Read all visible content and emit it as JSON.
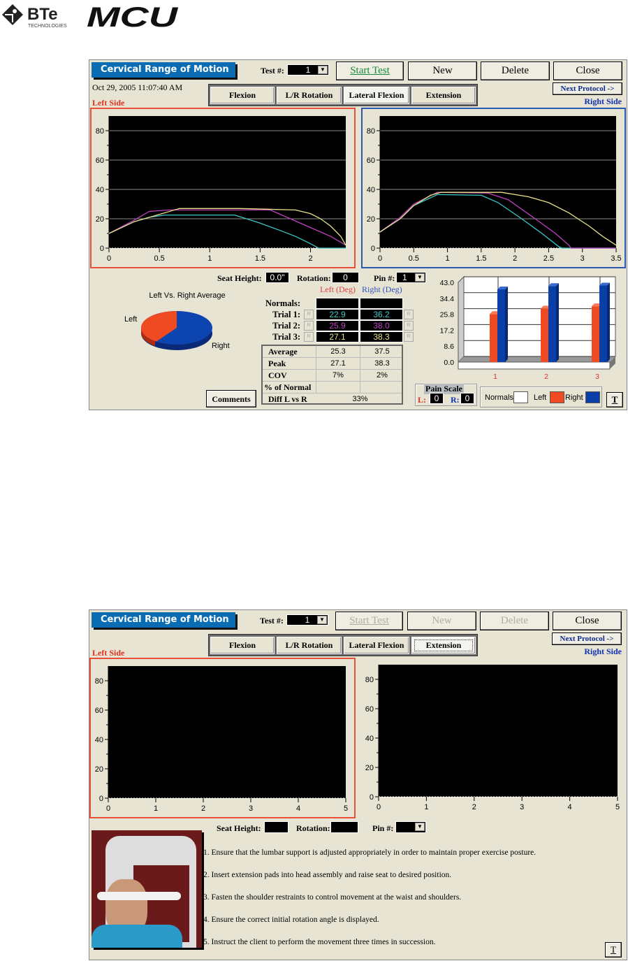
{
  "header": {
    "logo_left": "BTE TECHNOLOGIES",
    "logo_right": "MCU"
  },
  "panels": [
    {
      "title": "Cervical Range of Motion",
      "test_label": "Test #:",
      "test_value": "1",
      "buttons": {
        "start": "Start Test",
        "new": "New",
        "delete": "Delete",
        "close": "Close",
        "next": "Next Protocol ->",
        "comments": "Comments",
        "t": "T"
      },
      "buttons_disabled": false,
      "timestamp": "Oct 29, 2005 11:07:40 AM",
      "tabs": [
        "Flexion",
        "L/R Rotation",
        "Lateral Flexion",
        "Extension"
      ],
      "active_tab": 2,
      "left_side": "Left Side",
      "right_side": "Right Side",
      "seat_height_label": "Seat Height:",
      "seat_height": "0.0\"",
      "rotation_label": "Rotation:",
      "rotation": "0",
      "pin_label": "Pin #:",
      "pin": "1"
    },
    {
      "title": "Cervical Range of Motion",
      "test_label": "Test #:",
      "test_value": "1",
      "buttons": {
        "start": "Start Test",
        "new": "New",
        "delete": "Delete",
        "close": "Close",
        "next": "Next Protocol ->",
        "t": "T"
      },
      "buttons_disabled": true,
      "tabs": [
        "Flexion",
        "L/R Rotation",
        "Lateral Flexion",
        "Extension"
      ],
      "active_tab": 3,
      "left_side": "Left Side",
      "right_side": "Right Side",
      "seat_height_label": "Seat Height:",
      "seat_height": "",
      "rotation_label": "Rotation:",
      "rotation": "",
      "pin_label": "Pin #:",
      "pin": "",
      "instructions": [
        "1.  Ensure that the lumbar support is adjusted appropriately in order to maintain proper exercise posture.",
        "2.  Insert extension pads into head assembly and raise seat to desired position.",
        "3.  Fasten the shoulder restraints to control movement at the waist and shoulders.",
        "4.  Ensure the correct initial rotation angle is displayed.",
        "5.  Instruct the client to perform the movement three times in succession."
      ]
    }
  ],
  "results": {
    "left_deg": "Left (Deg)",
    "right_deg": "Right (Deg)",
    "r": "R",
    "rows": [
      {
        "label": "Normals:",
        "left": "",
        "right": ""
      },
      {
        "label": "Trial 1:",
        "left": "22.9",
        "right": "36.2"
      },
      {
        "label": "Trial 2:",
        "left": "25.9",
        "right": "38.0"
      },
      {
        "label": "Trial 3:",
        "left": "27.1",
        "right": "38.3"
      }
    ],
    "stats": [
      {
        "label": "Average",
        "left": "25.3",
        "right": "37.5"
      },
      {
        "label": "Peak",
        "left": "27.1",
        "right": "38.3"
      },
      {
        "label": "COV",
        "left": "7%",
        "right": "2%"
      },
      {
        "label": "% of Normal",
        "left": "",
        "right": ""
      }
    ],
    "diff_label": "Diff L vs R",
    "diff": "33%",
    "pain_label": "Pain Scale",
    "pain_l_label": "L:",
    "pain_l": "0",
    "pain_r_label": "R:",
    "pain_r": "0",
    "legend": {
      "normals": "Normals",
      "left": "Left",
      "right": "Right"
    }
  },
  "colors": {
    "left": "#f04a22",
    "right": "#0a3fa8",
    "trial1": "#3cc8c8",
    "trial2": "#c040c0",
    "trial3": "#e8e08a",
    "title": "#0a6db3",
    "start": "#1a8a3a"
  },
  "chart_data": [
    {
      "type": "line",
      "ylim": [
        0,
        90
      ],
      "xlim": [
        0,
        2.35
      ],
      "xticks": [
        0,
        0.5,
        1,
        1.5,
        2
      ],
      "yticks": [
        0,
        20,
        40,
        60,
        80
      ],
      "grid": true,
      "series": [
        {
          "color": "#3cc8c8",
          "points": [
            [
              0,
              10
            ],
            [
              0.25,
              18
            ],
            [
              0.4,
              21
            ],
            [
              0.55,
              22.5
            ],
            [
              1.25,
              22.5
            ],
            [
              1.5,
              17
            ],
            [
              1.7,
              12
            ],
            [
              1.85,
              8
            ],
            [
              2,
              3
            ],
            [
              2.08,
              0
            ],
            [
              2.35,
              0
            ]
          ]
        },
        {
          "color": "#c040c0",
          "points": [
            [
              0,
              10
            ],
            [
              0.25,
              19
            ],
            [
              0.4,
              25
            ],
            [
              0.6,
              26
            ],
            [
              1.6,
              26
            ],
            [
              1.8,
              20
            ],
            [
              2,
              14
            ],
            [
              2.2,
              8
            ],
            [
              2.35,
              2
            ]
          ]
        },
        {
          "color": "#e8e08a",
          "points": [
            [
              0,
              10
            ],
            [
              0.25,
              18
            ],
            [
              0.5,
              23
            ],
            [
              0.7,
              27
            ],
            [
              1.3,
              27
            ],
            [
              1.85,
              26
            ],
            [
              2,
              23.5
            ],
            [
              2.1,
              20
            ],
            [
              2.2,
              15
            ],
            [
              2.3,
              8
            ],
            [
              2.35,
              2
            ]
          ]
        }
      ]
    },
    {
      "type": "line",
      "ylim": [
        0,
        90
      ],
      "xlim": [
        0,
        3.5
      ],
      "xticks": [
        0,
        0.5,
        1,
        1.5,
        2,
        2.5,
        3,
        3.5
      ],
      "yticks": [
        0,
        20,
        40,
        60,
        80
      ],
      "grid": true,
      "series": [
        {
          "color": "#3cc8c8",
          "points": [
            [
              0,
              11
            ],
            [
              0.3,
              20
            ],
            [
              0.5,
              29
            ],
            [
              0.85,
              36.5
            ],
            [
              1.5,
              36
            ],
            [
              1.75,
              31
            ],
            [
              2.1,
              20
            ],
            [
              2.4,
              10
            ],
            [
              2.65,
              1
            ],
            [
              2.7,
              0
            ],
            [
              3.5,
              0
            ]
          ]
        },
        {
          "color": "#c040c0",
          "points": [
            [
              0,
              11
            ],
            [
              0.3,
              21
            ],
            [
              0.5,
              30
            ],
            [
              0.85,
              38
            ],
            [
              1.6,
              37.5
            ],
            [
              1.9,
              33
            ],
            [
              2.3,
              20
            ],
            [
              2.6,
              10
            ],
            [
              2.8,
              2
            ],
            [
              2.83,
              0
            ],
            [
              3.5,
              0
            ]
          ]
        },
        {
          "color": "#e8e08a",
          "points": [
            [
              0,
              11
            ],
            [
              0.3,
              20
            ],
            [
              0.5,
              29
            ],
            [
              0.75,
              36
            ],
            [
              0.9,
              38
            ],
            [
              1.8,
              38
            ],
            [
              2.2,
              35
            ],
            [
              2.5,
              31
            ],
            [
              2.8,
              24
            ],
            [
              3.1,
              15
            ],
            [
              3.3,
              8
            ],
            [
              3.5,
              2
            ]
          ]
        }
      ]
    },
    {
      "type": "pie",
      "title": "Left Vs. Right Average",
      "labels": [
        "Left",
        "Right"
      ],
      "values": [
        25.3,
        37.5
      ]
    },
    {
      "type": "bar",
      "categories": [
        "1",
        "2",
        "3"
      ],
      "series": [
        {
          "name": "Left",
          "values": [
            22.9,
            25.9,
            27.1
          ]
        },
        {
          "name": "Right",
          "values": [
            36.2,
            38.0,
            38.3
          ]
        }
      ],
      "ylim": [
        0,
        43
      ],
      "yticks": [
        "0.0",
        "8.6",
        "17.2",
        "25.8",
        "34.4",
        "43.0"
      ]
    },
    {
      "type": "line",
      "ylim": [
        0,
        90
      ],
      "xlim": [
        0,
        5
      ],
      "xticks": [
        0,
        1,
        2,
        3,
        4,
        5
      ],
      "yticks": [
        0,
        20,
        40,
        60,
        80
      ],
      "grid": false,
      "series": []
    },
    {
      "type": "line",
      "ylim": [
        0,
        90
      ],
      "xlim": [
        0,
        5
      ],
      "xticks": [
        0,
        1,
        2,
        3,
        4,
        5
      ],
      "yticks": [
        0,
        20,
        40,
        60,
        80
      ],
      "grid": false,
      "series": []
    }
  ]
}
